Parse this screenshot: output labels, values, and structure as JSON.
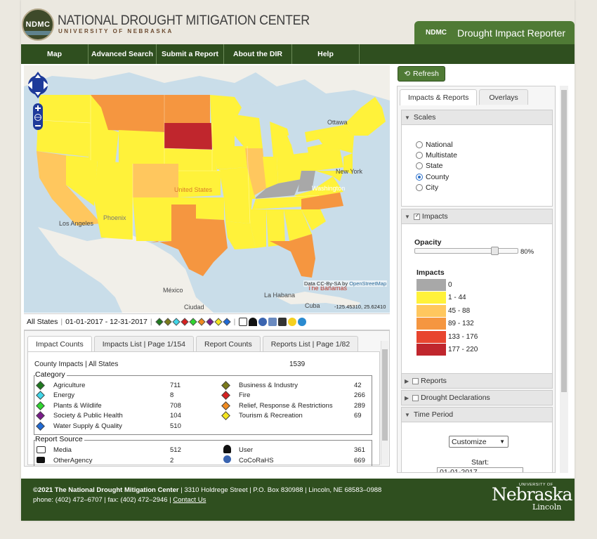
{
  "header": {
    "logo_text": "NDMC",
    "org_title": "NATIONAL DROUGHT MITIGATION CENTER",
    "org_subtitle": "UNIVERSITY OF NEBRASKA",
    "app_abbrev": "NDMC",
    "app_title": "Drought Impact Reporter"
  },
  "nav": [
    {
      "label": "Map"
    },
    {
      "label": "Advanced Search"
    },
    {
      "label": "Submit a Report"
    },
    {
      "label": "About the DIR"
    },
    {
      "label": "Help"
    }
  ],
  "map": {
    "labels": {
      "ottawa": "Ottawa",
      "new_york": "New York",
      "washington": "Washington",
      "united_states": "United States",
      "los_angeles": "Los Angeles",
      "phoenix": "Phoenix",
      "mexico": "México",
      "ciudad": "Ciudad",
      "la_habana": "La Habana",
      "cuba": "Cuba",
      "bahamas": "The Bahamas"
    },
    "attribution_prefix": "Data CC-By-SA by",
    "attribution_link": "OpenStreetMap",
    "coordinates": "-125.45310, 25.62410",
    "controls": {
      "pan": "pan-control",
      "zoom_in": "+",
      "zoom_out": "−"
    }
  },
  "filter": {
    "scope": "All States",
    "date_range": "01-01-2017 - 12-31-2017"
  },
  "left_tabs": [
    {
      "label": "Impact Counts"
    },
    {
      "label": "Impacts List | Page 1/154"
    },
    {
      "label": "Report Counts"
    },
    {
      "label": "Reports List | Page 1/82"
    }
  ],
  "impact_counts": {
    "header_label": "County Impacts | All States",
    "total": "1539",
    "category_legend": "Category",
    "categories": [
      {
        "name": "Agriculture",
        "count": "711",
        "color": "#1f7a1f"
      },
      {
        "name": "Energy",
        "count": "8",
        "color": "#3fd6e8"
      },
      {
        "name": "Plants & Wildlife",
        "count": "708",
        "color": "#2fd62f"
      },
      {
        "name": "Society & Public Health",
        "count": "104",
        "color": "#7a1a8a"
      },
      {
        "name": "Water Supply & Quality",
        "count": "510",
        "color": "#1f6ad6"
      },
      {
        "name": "Business & Industry",
        "count": "42",
        "color": "#7a7a1a"
      },
      {
        "name": "Fire",
        "count": "266",
        "color": "#d62020"
      },
      {
        "name": "Relief, Response & Restrictions",
        "count": "289",
        "color": "#f08a1f"
      },
      {
        "name": "Tourism & Recreation",
        "count": "69",
        "color": "#f5e61f"
      }
    ],
    "source_legend": "Report Source",
    "sources": [
      {
        "name": "Media",
        "count": "512"
      },
      {
        "name": "OtherAgency",
        "count": "2"
      },
      {
        "name": "User",
        "count": "361"
      },
      {
        "name": "CoCoRaHS",
        "count": "669"
      }
    ]
  },
  "right": {
    "refresh_label": "Refresh",
    "tabs": [
      {
        "label": "Impacts & Reports"
      },
      {
        "label": "Overlays"
      }
    ],
    "scales_title": "Scales",
    "scales": [
      {
        "label": "National"
      },
      {
        "label": "Multistate"
      },
      {
        "label": "State"
      },
      {
        "label": "County"
      },
      {
        "label": "City"
      }
    ],
    "selected_scale": "County",
    "impacts_title": "Impacts",
    "opacity_label": "Opacity",
    "opacity_value": "80%",
    "opacity_fraction": 0.8,
    "legend_title": "Impacts",
    "legend": [
      {
        "label": "0",
        "color": "#a8a8a8"
      },
      {
        "label": "1 - 44",
        "color": "#fff23a"
      },
      {
        "label": "45 - 88",
        "color": "#ffc75e"
      },
      {
        "label": "89 - 132",
        "color": "#f59640"
      },
      {
        "label": "133 - 176",
        "color": "#e8452f"
      },
      {
        "label": "177 - 220",
        "color": "#c0262d"
      }
    ],
    "reports_title": "Reports",
    "declarations_title": "Drought Declarations",
    "time_title": "Time Period",
    "time_select": "Customize",
    "start_label": "Start:",
    "start_value": "01-01-2017"
  },
  "footer": {
    "copyright": "©2021 The National Drought Mitigation Center",
    "address": "3310 Holdrege Street | P.O. Box 830988 | Lincoln, NE 68583–0988",
    "phone": "phone: (402) 472–6707 | fax: (402) 472–2946",
    "contact": "Contact Us",
    "logo_main": "Nebraska",
    "logo_top": "UNIVERSITY OF",
    "logo_bottom": "Lincoln"
  }
}
